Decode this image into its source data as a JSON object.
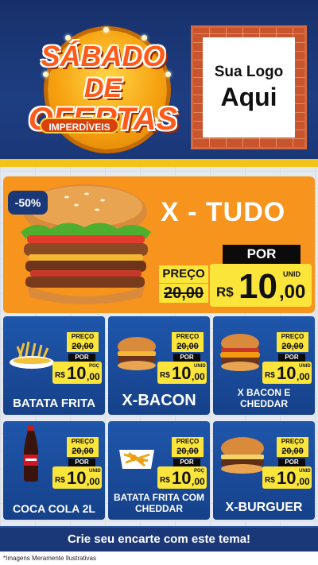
{
  "header": {
    "title_line1": "SÁBADO",
    "title_line2": "DE",
    "title_line3": "OFERTAS",
    "subtitle": "IMPERDÍVEIS",
    "logo_line1": "Sua Logo",
    "logo_line2": "Aqui"
  },
  "hero": {
    "discount": "-50%",
    "name": "X - TUDO",
    "preco_label": "PREÇO",
    "old_price": "20,00",
    "por_label": "POR",
    "currency": "R$",
    "price_int": "10",
    "price_dec": ",00",
    "unit": "UNID"
  },
  "products": [
    {
      "name": "BATATA FRITA",
      "preco_label": "PREÇO",
      "old_price": "20,00",
      "por_label": "POR",
      "currency": "R$",
      "price_int": "10",
      "price_dec": ",00",
      "unit": "POÇ"
    },
    {
      "name": "X-BACON",
      "preco_label": "PREÇO",
      "old_price": "20,00",
      "por_label": "POR",
      "currency": "R$",
      "price_int": "10",
      "price_dec": ",00",
      "unit": "UNID"
    },
    {
      "name": "X BACON E CHEDDAR",
      "preco_label": "PREÇO",
      "old_price": "20,00",
      "por_label": "POR",
      "currency": "R$",
      "price_int": "10",
      "price_dec": ",00",
      "unit": "UNID"
    },
    {
      "name": "COCA COLA 2L",
      "preco_label": "PREÇO",
      "old_price": "20,00",
      "por_label": "POR",
      "currency": "R$",
      "price_int": "10",
      "price_dec": ",00",
      "unit": "UNID"
    },
    {
      "name": "BATATA FRITA COM CHEDDAR",
      "preco_label": "PREÇO",
      "old_price": "20,00",
      "por_label": "POR",
      "currency": "R$",
      "price_int": "10",
      "price_dec": ",00",
      "unit": "POÇ"
    },
    {
      "name": "X-BURGUER",
      "preco_label": "PREÇO",
      "old_price": "20,00",
      "por_label": "POR",
      "currency": "R$",
      "price_int": "10",
      "price_dec": ",00",
      "unit": "UNID"
    }
  ],
  "footer": {
    "cta": "Crie seu encarte com este tema!",
    "disclaimer": "*Imagens Meramente Ilustrativas"
  },
  "colors": {
    "background": "#1d3a7a",
    "accent_orange": "#f7941d",
    "price_yellow": "#fce53b",
    "card_blue": "#1d4c9c"
  }
}
